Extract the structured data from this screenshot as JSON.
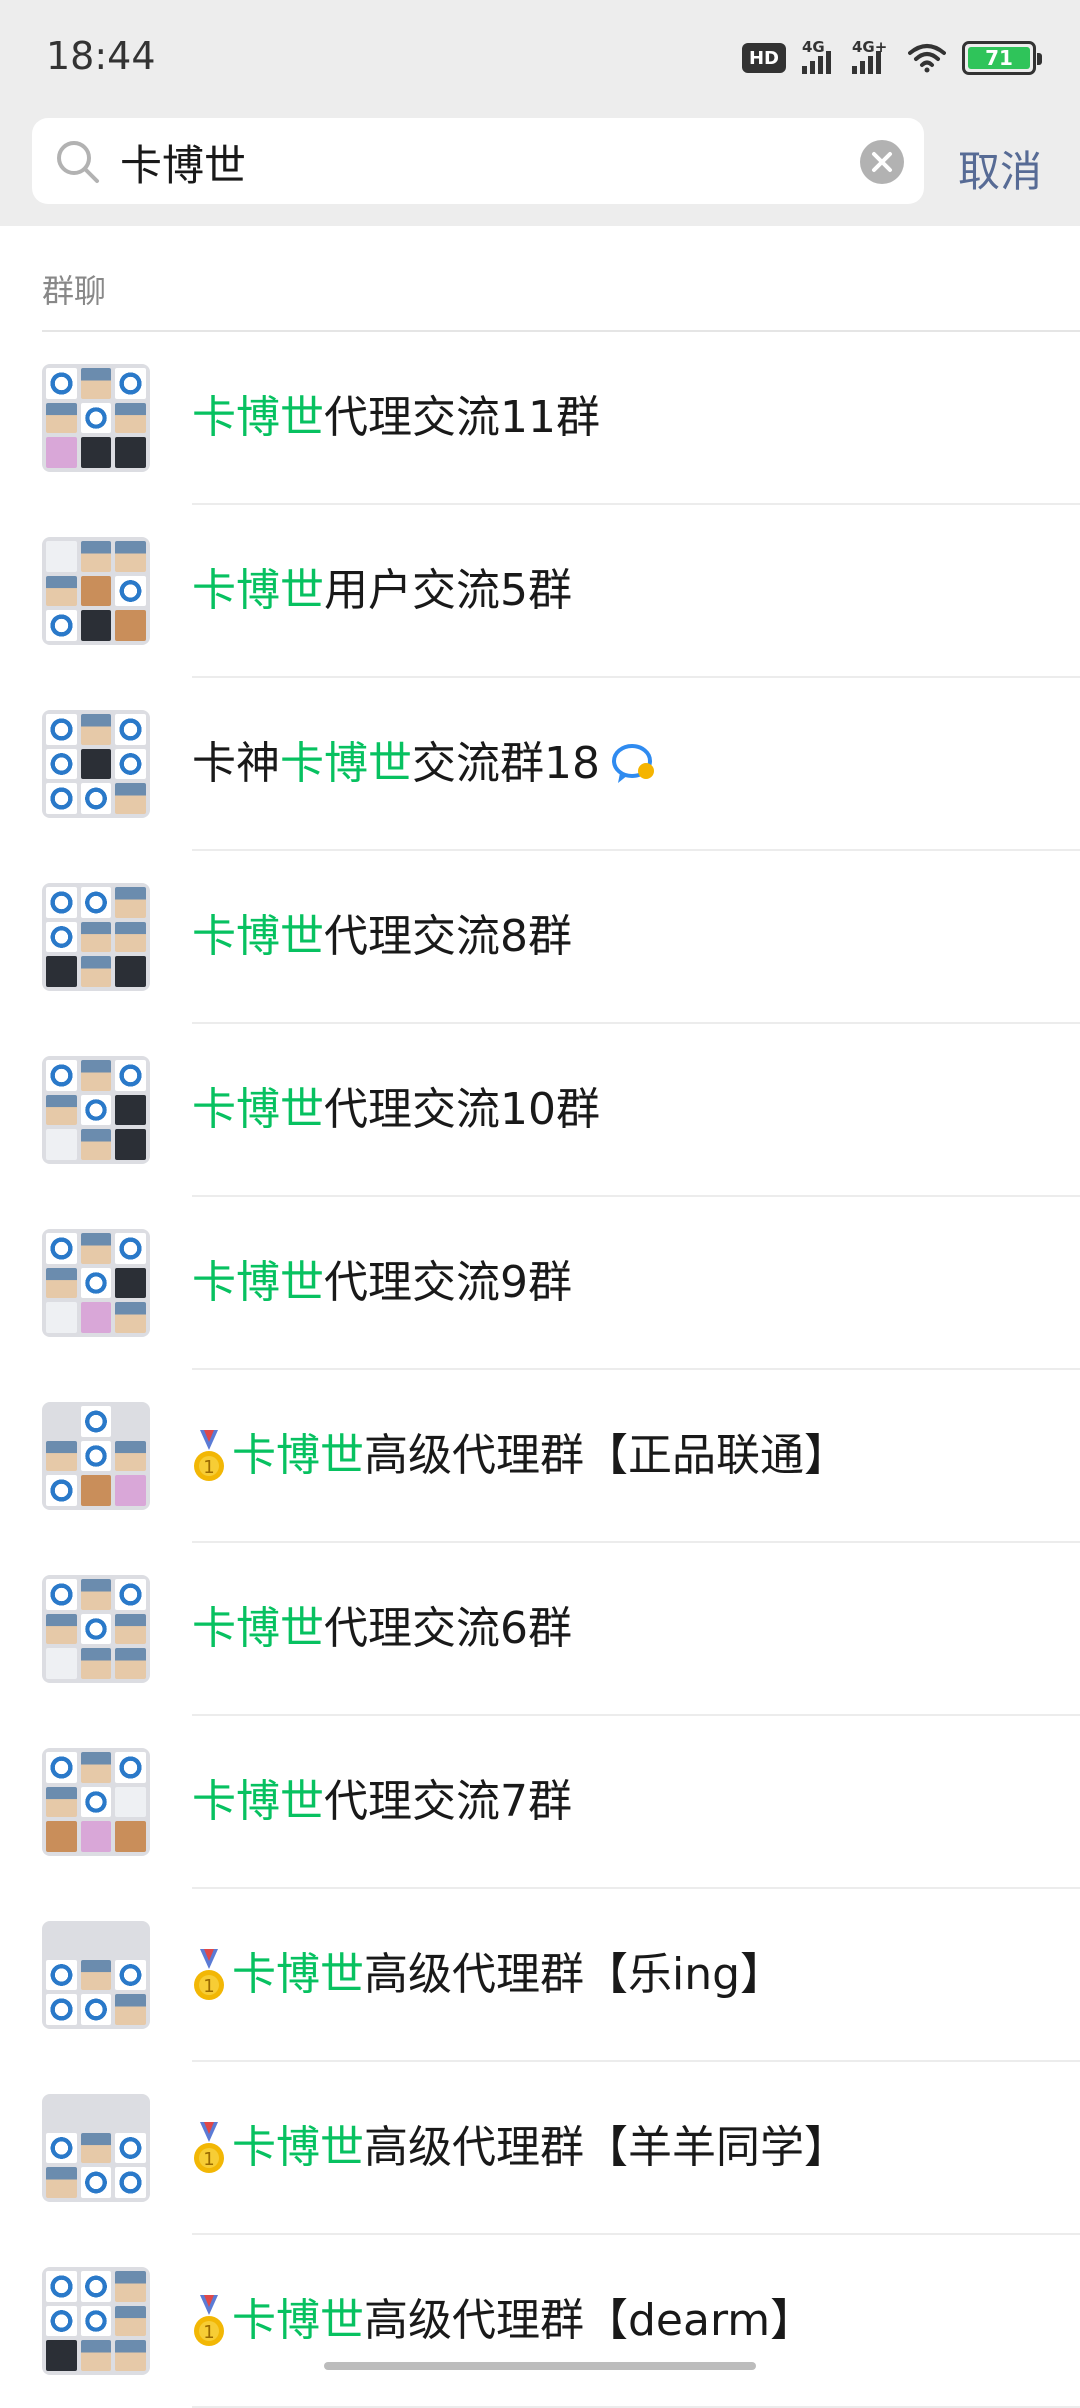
{
  "status_bar": {
    "time": "18:44",
    "hd_label": "HD",
    "signal1_label": "4G",
    "signal2_label": "4G+",
    "battery_level": "71",
    "battery_color": "#2fc45a"
  },
  "search": {
    "query": "卡博世",
    "search_icon": "search-icon",
    "clear_icon": "clear-icon",
    "cancel_label": "取消"
  },
  "section": {
    "title": "群聊"
  },
  "colors": {
    "highlight": "#07c160",
    "link": "#576b95",
    "background": "#ededed"
  },
  "results": [
    {
      "prefix": "",
      "highlight": "卡博世",
      "suffix": "代理交流11群",
      "medal": false,
      "chat_badge": false
    },
    {
      "prefix": "",
      "highlight": "卡博世",
      "suffix": "用户交流5群",
      "medal": false,
      "chat_badge": false
    },
    {
      "prefix": "卡神",
      "highlight": "卡博世",
      "suffix": "交流群18",
      "medal": false,
      "chat_badge": true
    },
    {
      "prefix": "",
      "highlight": "卡博世",
      "suffix": "代理交流8群",
      "medal": false,
      "chat_badge": false
    },
    {
      "prefix": "",
      "highlight": "卡博世",
      "suffix": "代理交流10群",
      "medal": false,
      "chat_badge": false
    },
    {
      "prefix": "",
      "highlight": "卡博世",
      "suffix": "代理交流9群",
      "medal": false,
      "chat_badge": false
    },
    {
      "prefix": "",
      "highlight": "卡博世",
      "suffix": "高级代理群【正品联通】",
      "medal": true,
      "chat_badge": false
    },
    {
      "prefix": "",
      "highlight": "卡博世",
      "suffix": "代理交流6群",
      "medal": false,
      "chat_badge": false
    },
    {
      "prefix": "",
      "highlight": "卡博世",
      "suffix": "代理交流7群",
      "medal": false,
      "chat_badge": false
    },
    {
      "prefix": "",
      "highlight": "卡博世",
      "suffix": "高级代理群【乐ing】",
      "medal": true,
      "chat_badge": false
    },
    {
      "prefix": "",
      "highlight": "卡博世",
      "suffix": "高级代理群【羊羊同学】",
      "medal": true,
      "chat_badge": false
    },
    {
      "prefix": "",
      "highlight": "卡博世",
      "suffix": "高级代理群【dearm】",
      "medal": true,
      "chat_badge": false
    }
  ]
}
